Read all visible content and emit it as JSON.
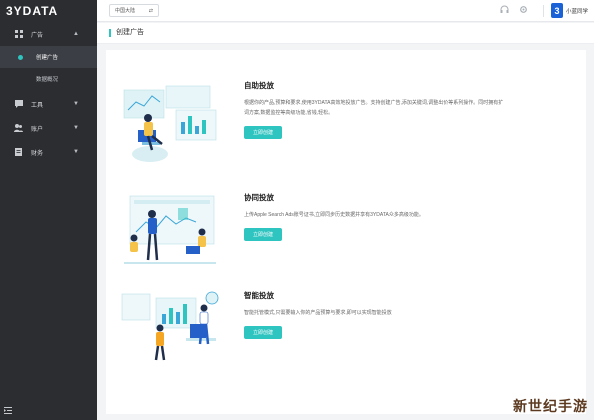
{
  "sidebar": {
    "logo": "3YDATA",
    "items": [
      {
        "label": "广告",
        "icon": "grid-icon",
        "caret": "▲"
      },
      {
        "label": "创建广告",
        "active": true
      },
      {
        "label": "数据概况"
      },
      {
        "label": "工具",
        "icon": "message-icon",
        "caret": "▼"
      },
      {
        "label": "账户",
        "icon": "users-icon",
        "caret": "▼"
      },
      {
        "label": "财务",
        "icon": "document-icon",
        "caret": "▼"
      }
    ],
    "footer_icon": "menu-fold-icon"
  },
  "topbar": {
    "region_label": "中国大陆",
    "region_icon": "swap-icon",
    "icons": [
      "headset-icon",
      "gear-icon"
    ],
    "user_name": "小蓝同学",
    "avatar_text": "3"
  },
  "page": {
    "title": "创建广告"
  },
  "cards": [
    {
      "title": "自助投放",
      "desc": "根据你的产品,预算和要求,使用3YDATA高效地投放广告。支持创建广告,添加关键词,调整出价等系列操作。同时拥有扩词方案,数据监控等高级功能,省钱,轻松。",
      "button": "立即创建"
    },
    {
      "title": "协同投放",
      "desc": "上传Apple Search Ads账号证书,立即同步历史数据并享有3YDATA众多高级功能。",
      "button": "立即创建"
    },
    {
      "title": "智能投放",
      "desc": "智能托管模式,只需要输入你的产品预算与要求,即可以实现智能投放",
      "button": "立即创建"
    }
  ],
  "watermark": "新世纪手游",
  "colors": {
    "accent": "#2ec4c0",
    "sidebar_bg": "#2b2d31",
    "brand_blue": "#1a62d6"
  }
}
